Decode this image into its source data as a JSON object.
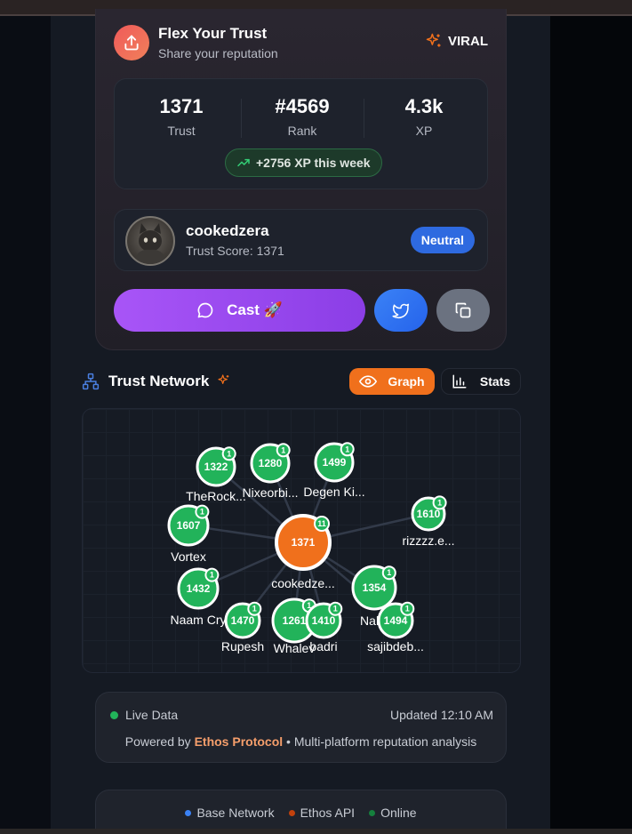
{
  "share": {
    "title": "Flex Your Trust",
    "subtitle": "Share your reputation",
    "viral_label": "VIRAL"
  },
  "stats": [
    {
      "value": "1371",
      "label": "Trust"
    },
    {
      "value": "#4569",
      "label": "Rank"
    },
    {
      "value": "4.3k",
      "label": "XP"
    }
  ],
  "xp_week": "+2756 XP this week",
  "user": {
    "name": "cookedzera",
    "score_text": "Trust Score: 1371",
    "badge": "Neutral"
  },
  "actions": {
    "cast_label": "Cast 🚀"
  },
  "network": {
    "title": "Trust Network",
    "graph_label": "Graph",
    "stats_label": "Stats"
  },
  "graph": {
    "center": {
      "score": "1371",
      "label": "cookedze...",
      "count": "11"
    },
    "nodes": [
      {
        "score": "1322",
        "label": "TheRock...",
        "count": "1"
      },
      {
        "score": "1280",
        "label": "Nixeorbi...",
        "count": "1"
      },
      {
        "score": "1499",
        "label": "Degen Ki...",
        "count": "1"
      },
      {
        "score": "1610",
        "label": "rizzzz.e...",
        "count": "1"
      },
      {
        "score": "1607",
        "label": "Vortex",
        "count": "1"
      },
      {
        "score": "1432",
        "label": "Naam Cry",
        "count": "1"
      },
      {
        "score": "1354",
        "label": "Nalin",
        "count": "1"
      },
      {
        "score": "1470",
        "label": "Rupesh",
        "count": "1"
      },
      {
        "score": "1261",
        "label": "Whalev",
        "count": "1"
      },
      {
        "score": "1410",
        "label": "badri",
        "count": "1"
      },
      {
        "score": "1494",
        "label": "sajibdeb...",
        "count": "1"
      }
    ]
  },
  "footer": {
    "live_label": "Live Data",
    "updated": "Updated 12:10 AM",
    "powered_prefix": "Powered by ",
    "powered_brand": "Ethos Protocol",
    "powered_suffix": " • Multi-platform reputation analysis"
  },
  "status": {
    "base": "Base Network",
    "ethos": "Ethos API",
    "online": "Online"
  },
  "colors": {
    "accent_orange": "#f0701c",
    "node_green": "#22b35a",
    "cast_purple": "#a855f7",
    "twitter_blue": "#3b82f6",
    "neutral_blue": "#2e6ae0"
  }
}
